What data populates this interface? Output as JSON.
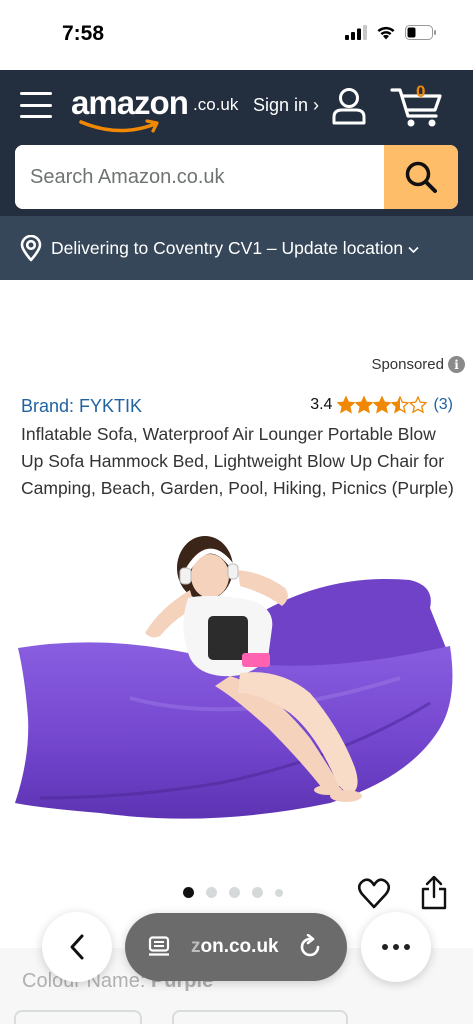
{
  "status_bar": {
    "time": "7:58"
  },
  "header": {
    "logo_word": "amazon",
    "logo_tld": ".co.uk",
    "sign_in": "Sign in ›",
    "cart_count": "0"
  },
  "search": {
    "placeholder": "Search Amazon.co.uk"
  },
  "location": {
    "text": "Delivering to Coventry CV1 – Update location"
  },
  "product": {
    "sponsored": "Sponsored",
    "brand": "Brand: FYKTIK",
    "rating_value": "3.4",
    "rating_count": "(3)",
    "rating": 3.4,
    "rating_max": 5,
    "title": "Inflatable Sofa, Waterproof Air Lounger Portable Blow Up Sofa Hammock Bed, Lightweight Blow Up Chair for Camping, Beach, Garden, Pool, Hiking, Picnics (Purple)",
    "image_count": 5,
    "active_image": 1
  },
  "variant": {
    "label": "Colour Name:",
    "value": "Purple"
  },
  "browser": {
    "url_prefix": "z",
    "url": "on.co.uk"
  },
  "colors": {
    "header_bg": "#232f3e",
    "location_bg": "#37475a",
    "search_button": "#febd69",
    "link": "#2162a1",
    "star": "#f08804",
    "sofa": "#7a4fd0"
  }
}
